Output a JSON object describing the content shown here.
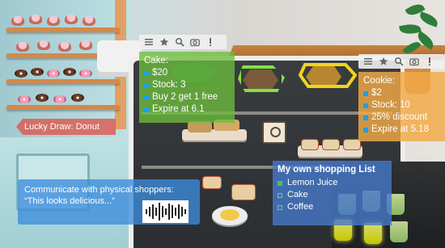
{
  "cake_card": {
    "title": "Cake:",
    "price": "$20",
    "stock": "Stock: 3",
    "promo": "Buy 2 get 1 free",
    "expire": "Expire at 6.1"
  },
  "cookie_card": {
    "title": "Cookie:",
    "price": "$2",
    "stock": "Stock: 10",
    "promo": "25%  discount",
    "expire": "Expire at  5.18"
  },
  "toolbar": {
    "icons": [
      "menu-icon",
      "star-icon",
      "zoom-icon",
      "camera-icon",
      "info-icon"
    ]
  },
  "lucky_draw": {
    "label": "Lucky Draw: Donut"
  },
  "communicate": {
    "line1": "Communicate with physical shoppers:",
    "line2": "“This looks delicious...”"
  },
  "shopping_list": {
    "title": "My own shopping List",
    "items": [
      {
        "label": "Lemon Juice",
        "checked": true
      },
      {
        "label": "Cake",
        "checked": false
      },
      {
        "label": "Coffee",
        "checked": false
      }
    ]
  },
  "colors": {
    "cake_panel": "#6dbe3c",
    "cookie_panel": "#f1aa46",
    "lucky_draw": "#dc5a50",
    "communicate": "#3c8cdc",
    "shopping_list": "#4678c8",
    "bullet": "#1aa0e6",
    "highlight_green": "#86e043",
    "highlight_yellow": "#f2d41a"
  }
}
